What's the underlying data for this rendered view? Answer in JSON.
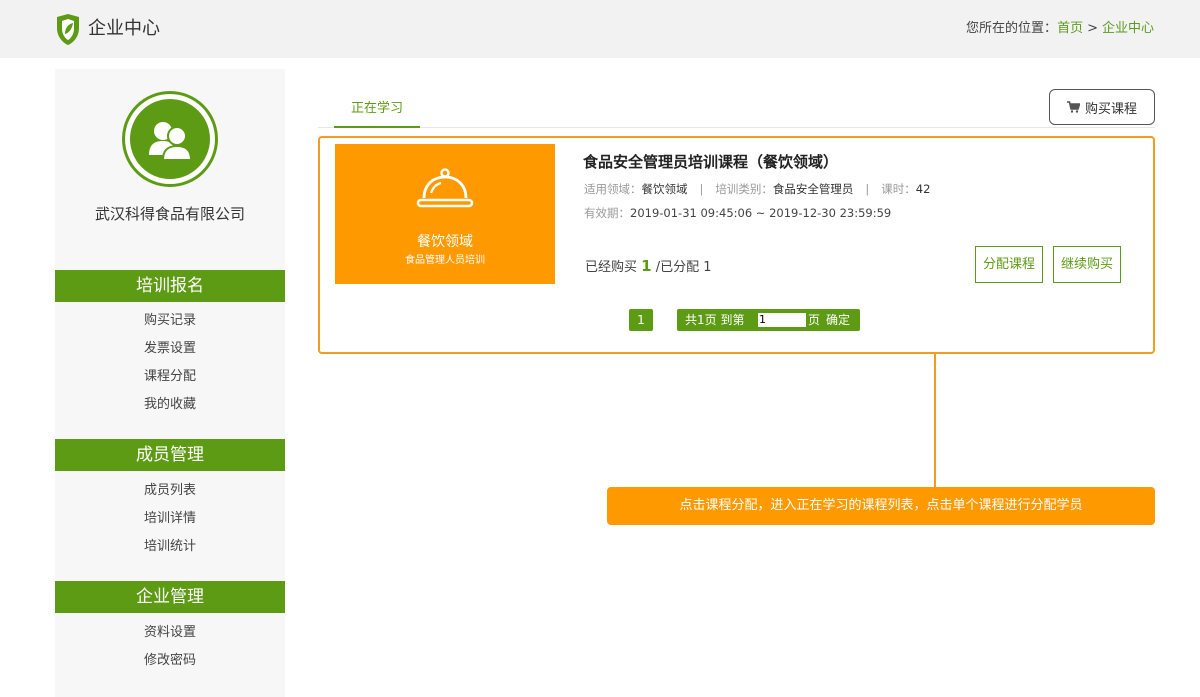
{
  "header": {
    "title": "企业中心",
    "breadcrumb_prefix": "您所在的位置：",
    "breadcrumb_home": "首页",
    "breadcrumb_sep": ">",
    "breadcrumb_current": "企业中心"
  },
  "sidebar": {
    "company_name": "武汉科得食品有限公司",
    "sections": [
      {
        "title": "培训报名",
        "items": [
          "购买记录",
          "发票设置",
          "课程分配",
          "我的收藏"
        ]
      },
      {
        "title": "成员管理",
        "items": [
          "成员列表",
          "培训详情",
          "培训统计"
        ]
      },
      {
        "title": "企业管理",
        "items": [
          "资料设置",
          "修改密码"
        ]
      }
    ]
  },
  "main": {
    "tab_active": "正在学习",
    "buy_button": "购买课程",
    "course": {
      "thumb_title": "餐饮领域",
      "thumb_subtitle": "食品管理人员培训",
      "title": "食品安全管理员培训课程（餐饮领域）",
      "field_label": "适用领域：",
      "field_value": "餐饮领域",
      "category_label": "培训类别：",
      "category_value": "食品安全管理员",
      "hours_label": "课时：",
      "hours_value": "42",
      "validity_label": "有效期：",
      "validity_value": "2019-01-31 09:45:06 ~ 2019-12-30 23:59:59",
      "purchased_prefix": "已经购买",
      "purchased_count": "1",
      "assigned_text": "/已分配 1",
      "assign_button": "分配课程",
      "continue_button": "继续购买"
    },
    "pagination": {
      "current_page": "1",
      "summary": "共1页 到第",
      "page_input_value": "1",
      "page_suffix": "页",
      "confirm": "确定"
    },
    "callout": "点击课程分配，进入正在学习的课程列表，点击单个课程进行分配学员"
  },
  "colors": {
    "brand_green": "#5e9b15",
    "accent_orange": "#ff9900",
    "border_orange": "#f39c1d"
  },
  "icons": {
    "logo": "shield-leaf-logo-icon",
    "avatar": "users-icon",
    "cart": "cart-icon",
    "thumb": "food-cloche-icon"
  }
}
